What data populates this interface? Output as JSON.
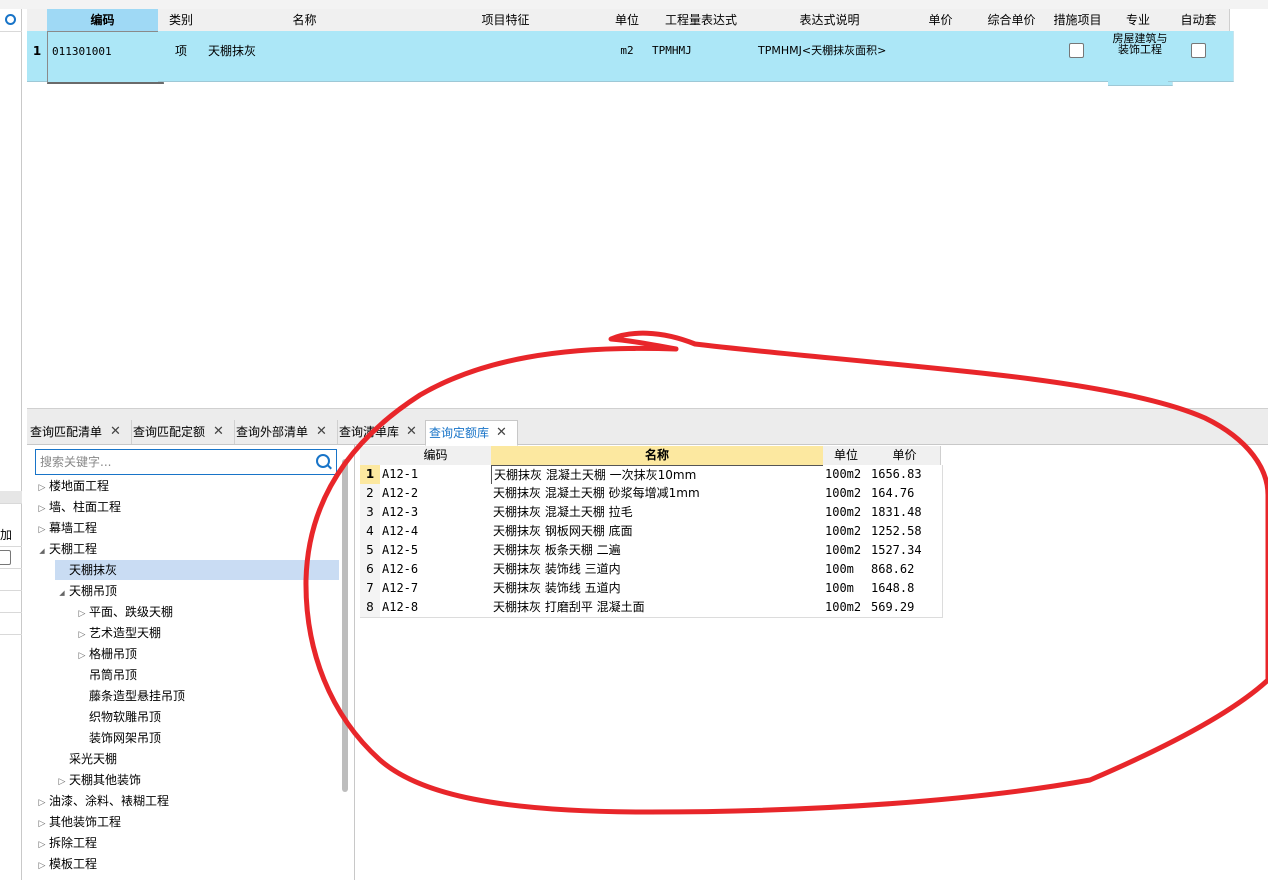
{
  "top_table": {
    "headers": [
      "编码",
      "类别",
      "名称",
      "项目特征",
      "单位",
      "工程量表达式",
      "表达式说明",
      "单价",
      "综合单价",
      "措施项目",
      "专业",
      "自动套"
    ],
    "row": {
      "index": "1",
      "code": "011301001",
      "category": "项",
      "name": "天棚抹灰",
      "features": "",
      "unit": "m2",
      "expression": "TPMHMJ",
      "expression_desc": "TPMHMJ<天棚抹灰面积>",
      "unit_price": "",
      "total_price": "",
      "measure_item": false,
      "specialty": "房屋建筑与装饰工程",
      "auto": false
    }
  },
  "left_strip": {
    "items": [
      "加"
    ]
  },
  "tabs": [
    {
      "label": "查询匹配清单",
      "active": false
    },
    {
      "label": "查询匹配定额",
      "active": false
    },
    {
      "label": "查询外部清单",
      "active": false
    },
    {
      "label": "查询清单库",
      "active": false
    },
    {
      "label": "查询定额库",
      "active": true
    }
  ],
  "search": {
    "placeholder": "搜索关键字..."
  },
  "tree": [
    {
      "label": "楼地面工程",
      "level": 0,
      "arrow": "right"
    },
    {
      "label": "墙、柱面工程",
      "level": 0,
      "arrow": "right"
    },
    {
      "label": "幕墙工程",
      "level": 0,
      "arrow": "right"
    },
    {
      "label": "天棚工程",
      "level": 0,
      "arrow": "down"
    },
    {
      "label": "天棚抹灰",
      "level": 1,
      "arrow": "none",
      "selected": true
    },
    {
      "label": "天棚吊顶",
      "level": 1,
      "arrow": "down"
    },
    {
      "label": "平面、跌级天棚",
      "level": 2,
      "arrow": "right"
    },
    {
      "label": "艺术造型天棚",
      "level": 2,
      "arrow": "right"
    },
    {
      "label": "格栅吊顶",
      "level": 2,
      "arrow": "right"
    },
    {
      "label": "吊筒吊顶",
      "level": 2,
      "arrow": "none"
    },
    {
      "label": "藤条造型悬挂吊顶",
      "level": 2,
      "arrow": "none"
    },
    {
      "label": "织物软雕吊顶",
      "level": 2,
      "arrow": "none"
    },
    {
      "label": "装饰网架吊顶",
      "level": 2,
      "arrow": "none"
    },
    {
      "label": "采光天棚",
      "level": 1,
      "arrow": "none"
    },
    {
      "label": "天棚其他装饰",
      "level": 1,
      "arrow": "right"
    },
    {
      "label": "油漆、涂料、裱糊工程",
      "level": 0,
      "arrow": "right"
    },
    {
      "label": "其他装饰工程",
      "level": 0,
      "arrow": "right"
    },
    {
      "label": "拆除工程",
      "level": 0,
      "arrow": "right"
    },
    {
      "label": "模板工程",
      "level": 0,
      "arrow": "right"
    }
  ],
  "quota_table": {
    "headers": [
      "编码",
      "名称",
      "单位",
      "单价"
    ],
    "rows": [
      {
        "n": "1",
        "code": "A12-1",
        "name": "天棚抹灰 混凝土天棚 一次抹灰10mm",
        "unit": "100m2",
        "price": "1656.83"
      },
      {
        "n": "2",
        "code": "A12-2",
        "name": "天棚抹灰 混凝土天棚 砂浆每增减1mm",
        "unit": "100m2",
        "price": "164.76"
      },
      {
        "n": "3",
        "code": "A12-3",
        "name": "天棚抹灰 混凝土天棚 拉毛",
        "unit": "100m2",
        "price": "1831.48"
      },
      {
        "n": "4",
        "code": "A12-4",
        "name": "天棚抹灰 钢板网天棚 底面",
        "unit": "100m2",
        "price": "1252.58"
      },
      {
        "n": "5",
        "code": "A12-5",
        "name": "天棚抹灰 板条天棚 二遍",
        "unit": "100m2",
        "price": "1527.34"
      },
      {
        "n": "6",
        "code": "A12-6",
        "name": "天棚抹灰 装饰线 三道内",
        "unit": "100m",
        "price": "868.62"
      },
      {
        "n": "7",
        "code": "A12-7",
        "name": "天棚抹灰 装饰线 五道内",
        "unit": "100m",
        "price": "1648.8"
      },
      {
        "n": "8",
        "code": "A12-8",
        "name": "天棚抹灰 打磨刮平 混凝土面",
        "unit": "100m2",
        "price": "569.29"
      }
    ]
  },
  "colors": {
    "selection_blue": "#ace7f7",
    "header_highlight": "#fce8a0",
    "annotation_red": "#e8262a",
    "accent": "#1874c8"
  }
}
